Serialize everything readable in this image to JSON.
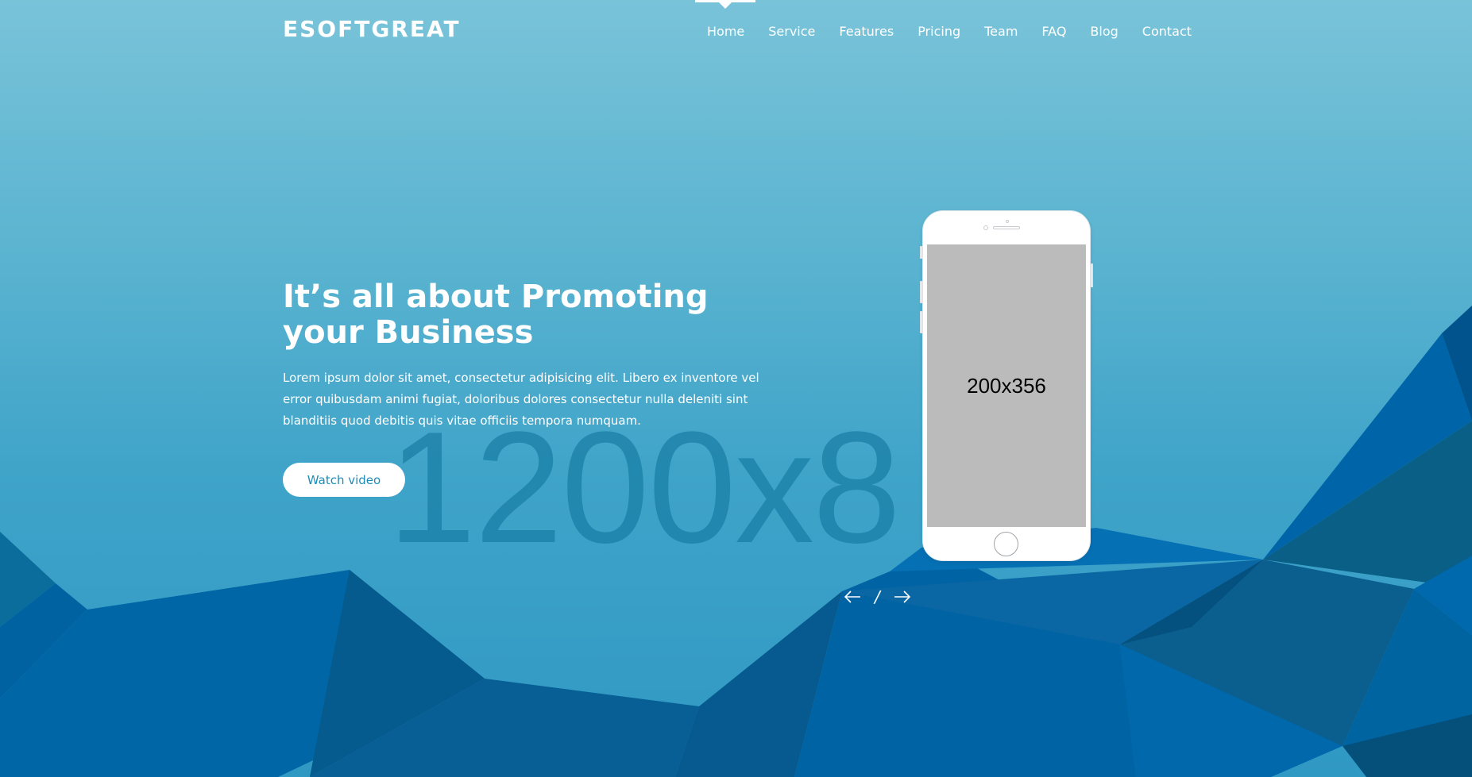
{
  "header": {
    "logo": "ESOFTGREAT",
    "nav": [
      {
        "label": "Home"
      },
      {
        "label": "Service"
      },
      {
        "label": "Features"
      },
      {
        "label": "Pricing"
      },
      {
        "label": "Team"
      },
      {
        "label": "FAQ"
      },
      {
        "label": "Blog"
      },
      {
        "label": "Contact"
      }
    ],
    "active_nav": "Home"
  },
  "hero": {
    "title": "It’s all about Promoting your Business",
    "text": "Lorem ipsum dolor sit amet, consectetur adipisicing elit. Libero ex inventore vel error quibusdam animi fugiat, doloribus dolores consectetur nulla deleniti sint blanditiis quod debitis quis vitae officiis tempora numquam.",
    "watch_button": "Watch video",
    "background_placeholder": "1200x8"
  },
  "phone": {
    "screen_placeholder": "200x356"
  },
  "slider": {
    "separator": "/",
    "prev_icon": "arrow-left-icon",
    "next_icon": "arrow-right-icon"
  },
  "colors": {
    "sky_top": "#79c3d9",
    "sky_bottom": "#2f98c3",
    "polygon_dark": "#005a8c",
    "polygon_mid": "#0069a8",
    "button_text": "#1e8cb8"
  }
}
